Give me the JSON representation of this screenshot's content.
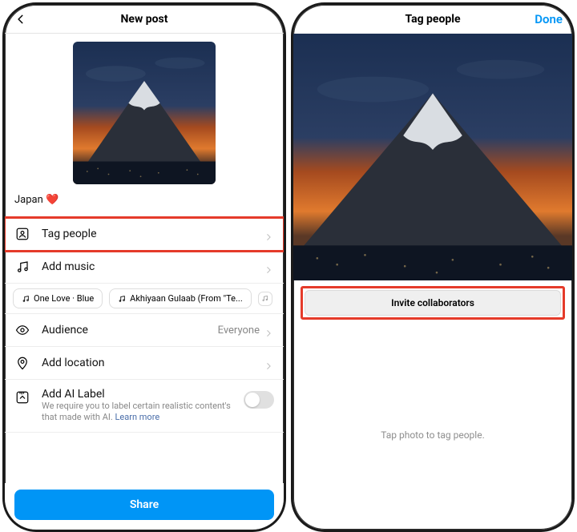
{
  "left": {
    "header": {
      "title": "New post"
    },
    "caption": "Japan ❤️",
    "rows": {
      "tag": {
        "label": "Tag people"
      },
      "music": {
        "label": "Add music"
      },
      "audience": {
        "label": "Audience",
        "value": "Everyone"
      },
      "location": {
        "label": "Add location"
      },
      "ai": {
        "label": "Add AI Label",
        "sub": "We require you to label certain realistic content's that made with AI. ",
        "learn": "Learn more"
      }
    },
    "chips": [
      "One Love · Blue",
      "Akhiyaan Gulaab (From \"Te..."
    ],
    "share": "Share"
  },
  "right": {
    "header": {
      "title": "Tag people",
      "done": "Done"
    },
    "invite": "Invite collaborators",
    "hint": "Tap photo to tag people."
  }
}
